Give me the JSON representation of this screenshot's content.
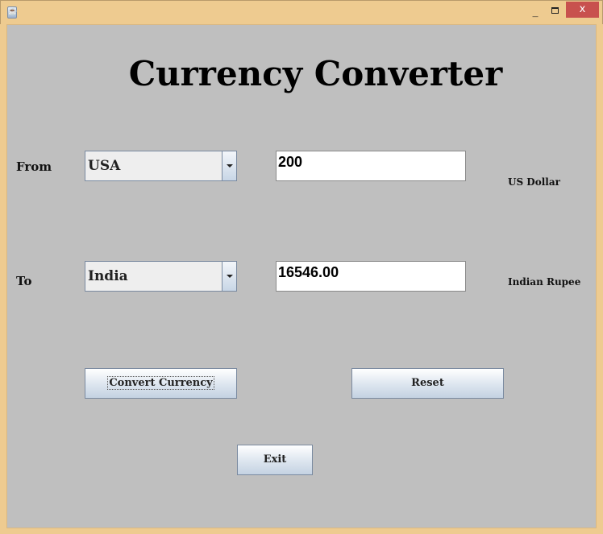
{
  "window": {
    "close_glyph": "x",
    "minimize_glyph": "_"
  },
  "title": "Currency Converter",
  "from": {
    "label": "From",
    "country": "USA",
    "amount": "200",
    "currency_name": "US Dollar"
  },
  "to": {
    "label": "To",
    "country": "India",
    "amount": "16546.00",
    "currency_name": "Indian Rupee"
  },
  "buttons": {
    "convert": "Convert Currency",
    "reset": "Reset",
    "exit": "Exit"
  }
}
